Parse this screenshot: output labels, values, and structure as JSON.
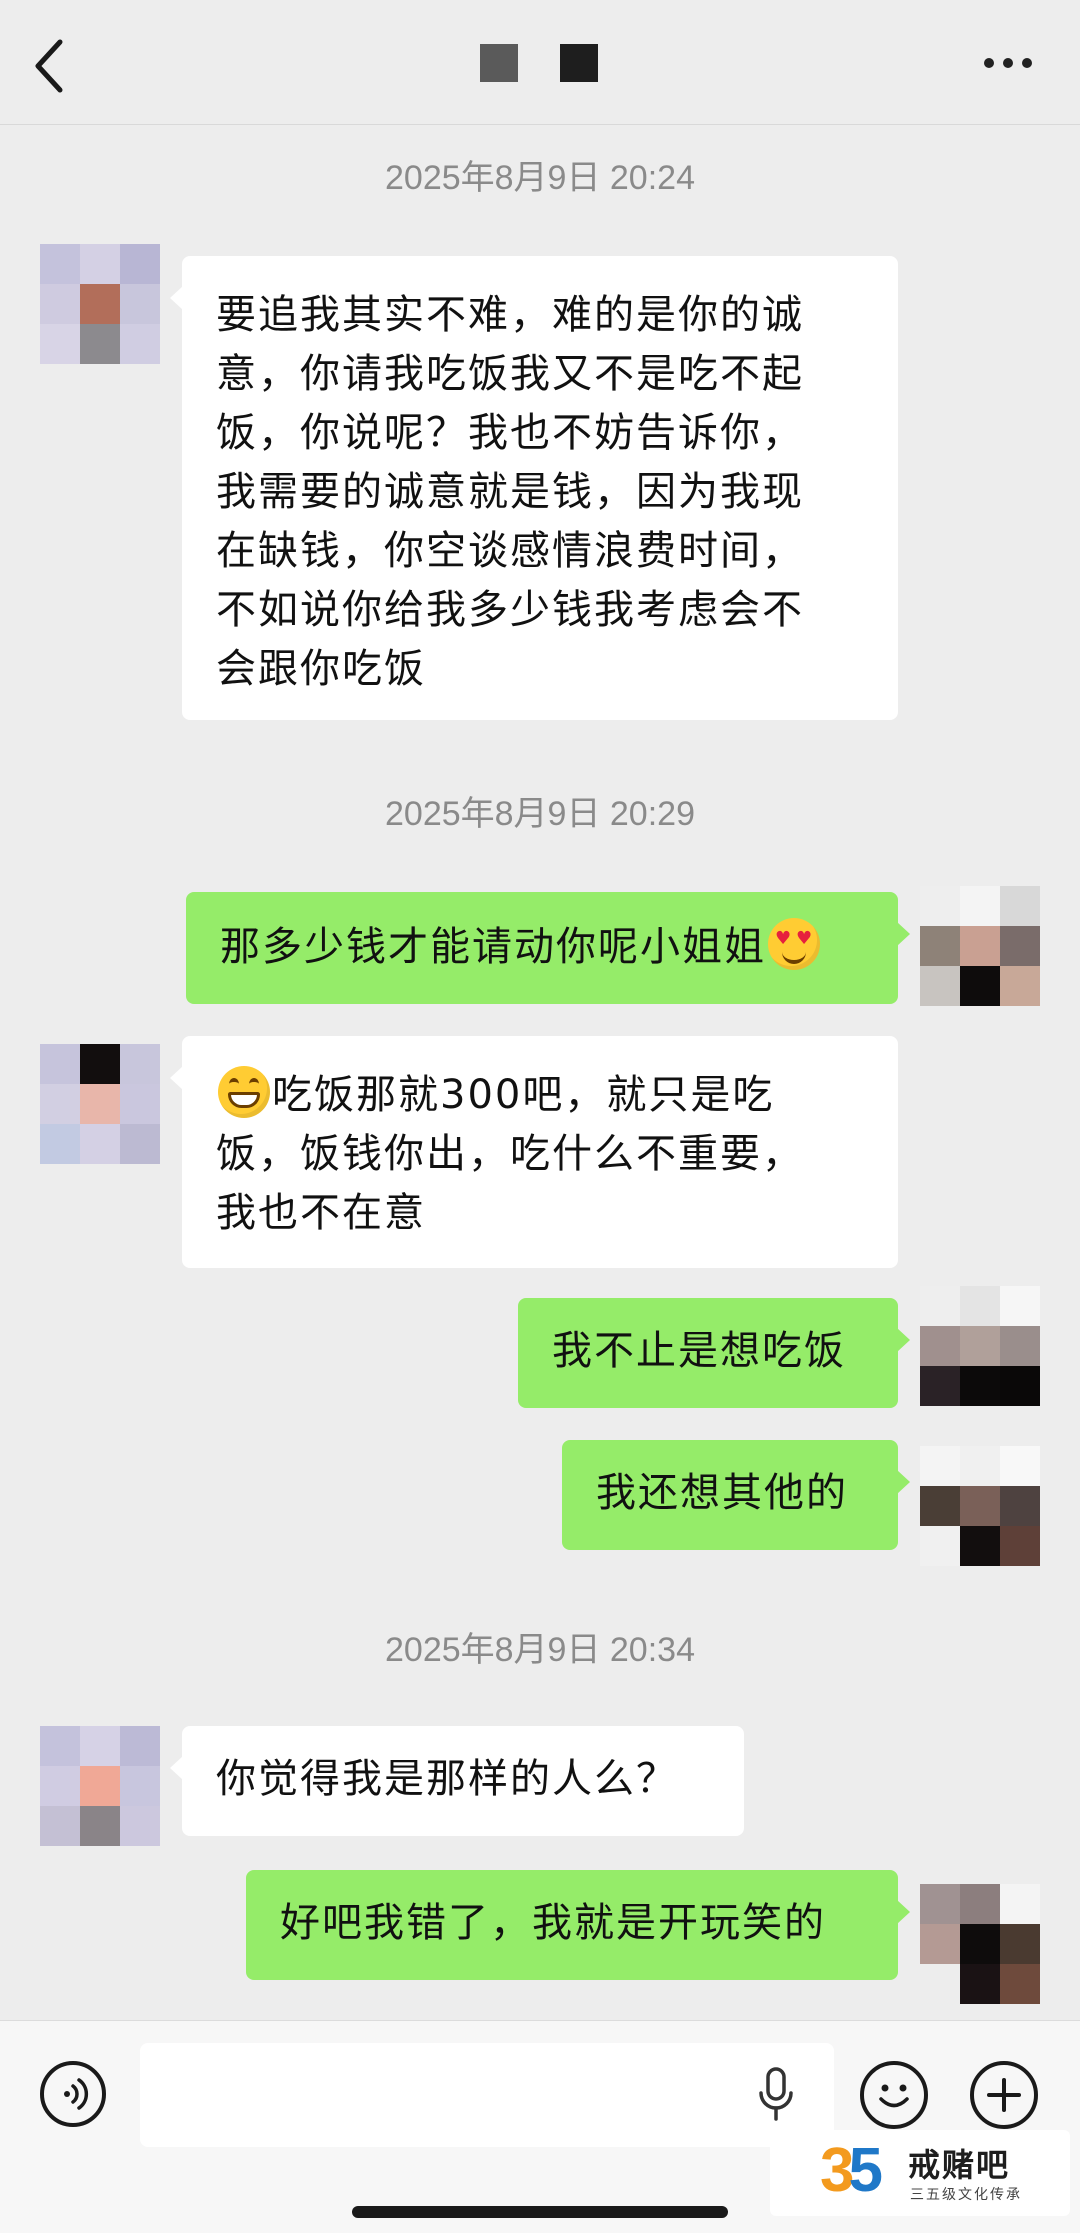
{
  "header": {
    "back_icon": "chevron-left-icon",
    "title_redacted": true,
    "more_icon": "ellipsis-icon"
  },
  "messages": [
    {
      "type": "timestamp",
      "text": "2025年8月9日 20:24"
    },
    {
      "type": "received",
      "lines": [
        "要追我其实不难，难的是你的诚",
        "意，你请我吃饭我又不是吃不起",
        "饭，你说呢？我也不妨告诉你，",
        "我需要的诚意就是钱，因为我现",
        "在缺钱，你空谈感情浪费时间，",
        "不如说你给我多少钱我考虑会不",
        "会跟你吃饭"
      ]
    },
    {
      "type": "timestamp",
      "text": "2025年8月9日 20:29"
    },
    {
      "type": "sent",
      "text": "那多少钱才能请动你呢小姐姐",
      "emoji": "heart-eyes-emoji"
    },
    {
      "type": "received",
      "emoji": "grinning-emoji",
      "lines": [
        "吃饭那就300吧，就只是吃",
        "饭，饭钱你出，吃什么不重要，",
        "我也不在意"
      ]
    },
    {
      "type": "sent",
      "text": "我不止是想吃饭"
    },
    {
      "type": "sent",
      "text": "我还想其他的"
    },
    {
      "type": "timestamp",
      "text": "2025年8月9日 20:34"
    },
    {
      "type": "received",
      "lines": [
        "你觉得我是那样的人么？"
      ]
    },
    {
      "type": "sent",
      "text": "好吧我错了，我就是开玩笑的"
    }
  ],
  "input_bar": {
    "voice_icon": "voice-wave-icon",
    "input_value": "",
    "mic_icon": "microphone-icon",
    "emoji_icon": "smiley-icon",
    "plus_icon": "plus-circle-icon"
  },
  "watermark": {
    "number": "35",
    "name": "戒赌吧",
    "subtitle": "三五级文化传承"
  },
  "colors": {
    "background": "#ededed",
    "sent_bubble": "#95ec69",
    "received_bubble": "#ffffff",
    "timestamp_text": "#8a8a8a"
  }
}
